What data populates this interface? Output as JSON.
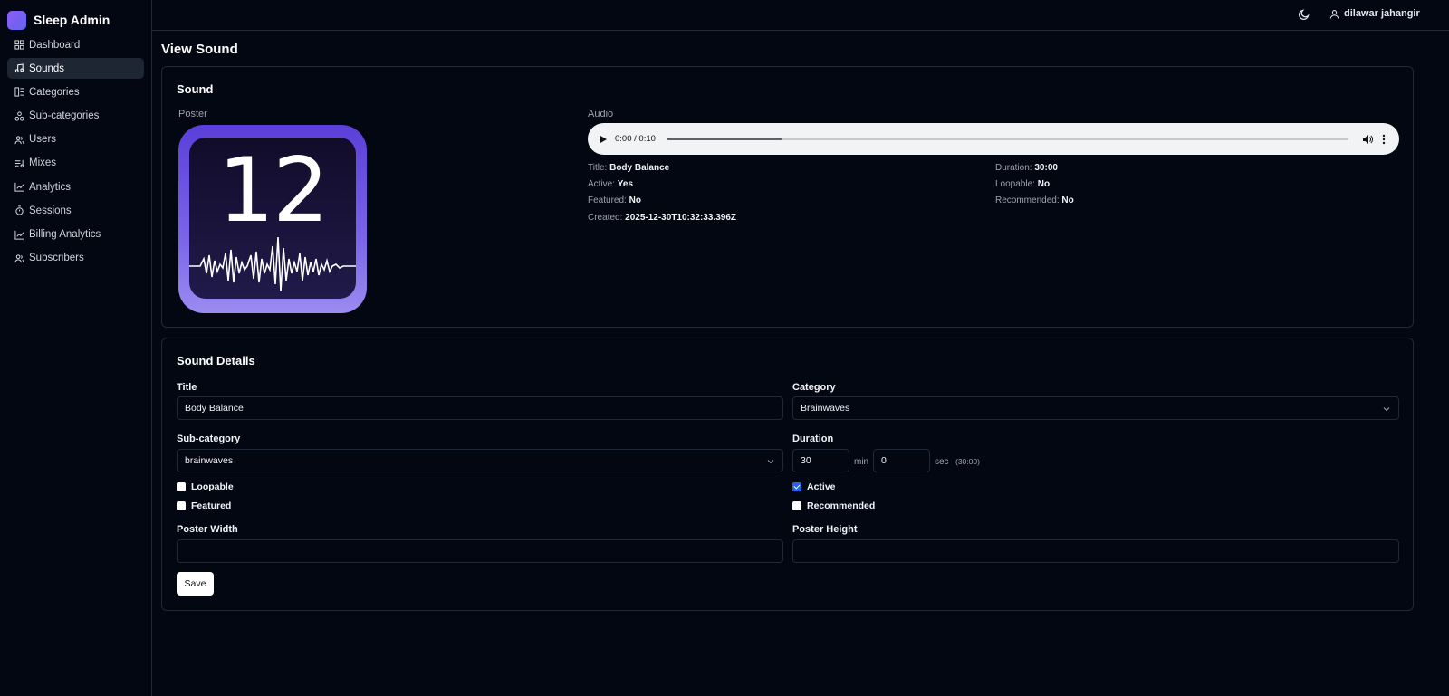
{
  "app": {
    "title": "Sleep Admin"
  },
  "sidebar": {
    "items": [
      {
        "label": "Dashboard",
        "icon": "dashboard-icon"
      },
      {
        "label": "Sounds",
        "icon": "music-note-icon",
        "active": true
      },
      {
        "label": "Categories",
        "icon": "categories-icon"
      },
      {
        "label": "Sub-categories",
        "icon": "subcategories-icon"
      },
      {
        "label": "Users",
        "icon": "users-icon"
      },
      {
        "label": "Mixes",
        "icon": "mixes-icon"
      },
      {
        "label": "Analytics",
        "icon": "line-chart-icon"
      },
      {
        "label": "Sessions",
        "icon": "timer-icon"
      },
      {
        "label": "Billing Analytics",
        "icon": "line-chart-icon"
      },
      {
        "label": "Subscribers",
        "icon": "users-icon"
      }
    ]
  },
  "header": {
    "user_name": "dilawar jahangir",
    "theme_icon": "moon-icon"
  },
  "page": {
    "title": "View Sound"
  },
  "sound_card": {
    "title": "Sound",
    "poster_label": "Poster",
    "poster_text": "12",
    "audio_label": "Audio",
    "audio_time": "0:00 / 0:10",
    "audio_progress": 0.17,
    "meta": {
      "title_label": "Title:",
      "title_value": "Body Balance",
      "active_label": "Active:",
      "active_value": "Yes",
      "featured_label": "Featured:",
      "featured_value": "No",
      "created_label": "Created:",
      "created_value": "2025-12-30T10:32:33.396Z",
      "duration_label": "Duration:",
      "duration_value": "30:00",
      "loopable_label": "Loopable:",
      "loopable_value": "No",
      "recommended_label": "Recommended:",
      "recommended_value": "No"
    }
  },
  "details": {
    "title": "Sound Details",
    "title_label": "Title",
    "title_value": "Body Balance",
    "category_label": "Category",
    "category_value": "Brainwaves",
    "subcategory_label": "Sub-category",
    "subcategory_value": "brainwaves",
    "duration_label": "Duration",
    "duration_min": "30",
    "min_unit": "min",
    "duration_sec": "0",
    "sec_unit": "sec",
    "duration_hint": "(30:00)",
    "loopable_label": "Loopable",
    "loopable_checked": false,
    "featured_label": "Featured",
    "featured_checked": false,
    "active_label": "Active",
    "active_checked": true,
    "recommended_label": "Recommended",
    "recommended_checked": false,
    "poster_width_label": "Poster Width",
    "poster_width_value": "",
    "poster_height_label": "Poster Height",
    "poster_height_value": "",
    "save_label": "Save"
  },
  "colors": {
    "background": "#030712",
    "border": "#1f2937",
    "accent": "#2563eb",
    "brand": "#8b5cf6"
  }
}
